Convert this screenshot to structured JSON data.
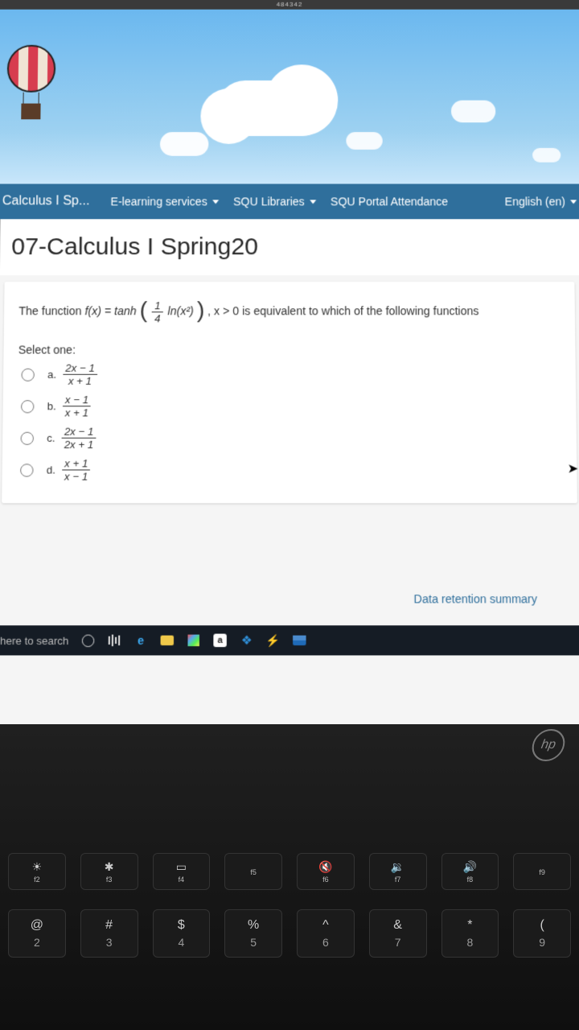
{
  "browser_fragment": "484342",
  "nav": {
    "brand": "Calculus I Sp...",
    "items": [
      "E-learning services",
      "SQU Libraries",
      "SQU Portal Attendance"
    ],
    "lang": "English (en)"
  },
  "page_title": "07-Calculus I Spring20",
  "question": {
    "prefix": "The function ",
    "fx": "f(x) = tanh",
    "inner_num": "1",
    "inner_den": "4",
    "inner_ln": "ln(x²)",
    "suffix": ", x > 0 is equivalent to which of the following functions",
    "select_label": "Select one:",
    "options": [
      {
        "letter": "a.",
        "num": "2x − 1",
        "den": "x + 1"
      },
      {
        "letter": "b.",
        "num": "x − 1",
        "den": "x + 1"
      },
      {
        "letter": "c.",
        "num": "2x − 1",
        "den": "2x + 1"
      },
      {
        "letter": "d.",
        "num": "x + 1",
        "den": "x − 1"
      }
    ]
  },
  "retention_link": "Data retention summary",
  "taskbar": {
    "search_placeholder": "here to search"
  },
  "hp": "hp",
  "fn_keys": [
    {
      "label": "f2",
      "sym": "☀"
    },
    {
      "label": "f3",
      "sym": "✱"
    },
    {
      "label": "f4",
      "sym": "▭"
    },
    {
      "label": "f5",
      "sym": ""
    },
    {
      "label": "f6",
      "sym": "🔇"
    },
    {
      "label": "f7",
      "sym": "🔉"
    },
    {
      "label": "f8",
      "sym": "🔊"
    },
    {
      "label": "f9",
      "sym": ""
    }
  ],
  "num_keys": [
    {
      "top": "@",
      "bot": "2"
    },
    {
      "top": "#",
      "bot": "3"
    },
    {
      "top": "$",
      "bot": "4"
    },
    {
      "top": "%",
      "bot": "5"
    },
    {
      "top": "^",
      "bot": "6"
    },
    {
      "top": "&",
      "bot": "7"
    },
    {
      "top": "*",
      "bot": "8"
    },
    {
      "top": "(",
      "bot": "9"
    }
  ]
}
